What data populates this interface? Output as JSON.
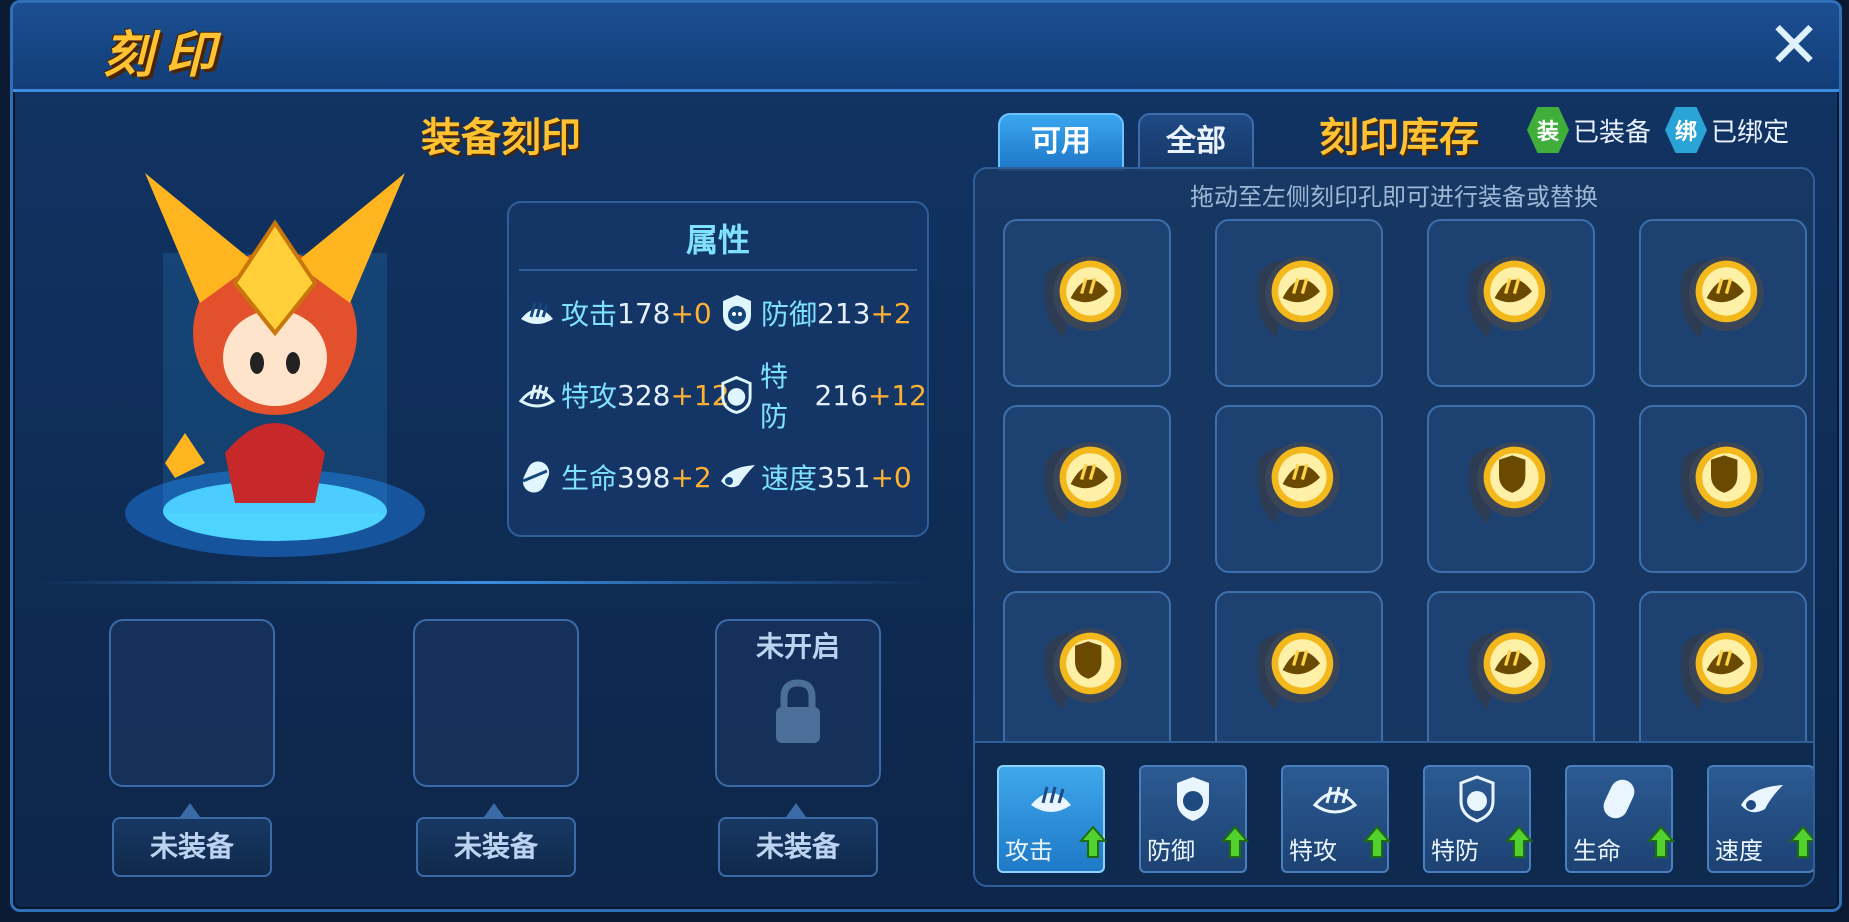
{
  "window": {
    "title": "刻印",
    "close_icon": "close-icon"
  },
  "left": {
    "section_title": "装备刻印",
    "attributes": {
      "title": "属性",
      "stats": [
        {
          "name": "攻击",
          "value": "178",
          "bonus": "+0",
          "icon": "attack-icon"
        },
        {
          "name": "防御",
          "value": "213",
          "bonus": "+2",
          "icon": "defense-icon"
        },
        {
          "name": "特攻",
          "value": "328",
          "bonus": "+12",
          "icon": "special-attack-icon"
        },
        {
          "name": "特防",
          "value": "216",
          "bonus": "+12",
          "icon": "special-defense-icon"
        },
        {
          "name": "生命",
          "value": "398",
          "bonus": "+2",
          "icon": "hp-icon"
        },
        {
          "name": "速度",
          "value": "351",
          "bonus": "+0",
          "icon": "speed-icon"
        }
      ]
    },
    "slots": [
      {
        "state": "empty",
        "label": "未装备"
      },
      {
        "state": "empty",
        "label": "未装备"
      },
      {
        "state": "locked",
        "locked_text": "未开启",
        "label": "未装备"
      }
    ]
  },
  "right": {
    "tabs": [
      {
        "label": "可用",
        "active": true
      },
      {
        "label": "全部",
        "active": false
      }
    ],
    "section_title": "刻印库存",
    "legend": [
      {
        "badge": "装",
        "text": "已装备",
        "color": "#3fae3a"
      },
      {
        "badge": "绑",
        "text": "已绑定",
        "color": "#2aa3d6"
      }
    ],
    "hint": "拖动至左侧刻印孔即可进行装备或替换",
    "inventory": [
      "attack-emblem",
      "attack-emblem",
      "attack-emblem",
      "attack-emblem",
      "attack-emblem",
      "attack-emblem",
      "defense-emblem",
      "defense-emblem",
      "defense-emblem",
      "attack-emblem",
      "attack-emblem",
      "attack-emblem"
    ],
    "filters": [
      {
        "label": "攻击",
        "icon": "attack-icon",
        "active": true
      },
      {
        "label": "防御",
        "icon": "defense-icon",
        "active": false
      },
      {
        "label": "特攻",
        "icon": "special-attack-icon",
        "active": false
      },
      {
        "label": "特防",
        "icon": "special-defense-icon",
        "active": false
      },
      {
        "label": "生命",
        "icon": "hp-icon",
        "active": false
      },
      {
        "label": "速度",
        "icon": "speed-icon",
        "active": false
      }
    ]
  },
  "colors": {
    "accent_gold": "#ffc233",
    "stat_cyan": "#7fe0ff",
    "bonus_orange": "#ffb032",
    "upgrade_green": "#53d12f"
  }
}
